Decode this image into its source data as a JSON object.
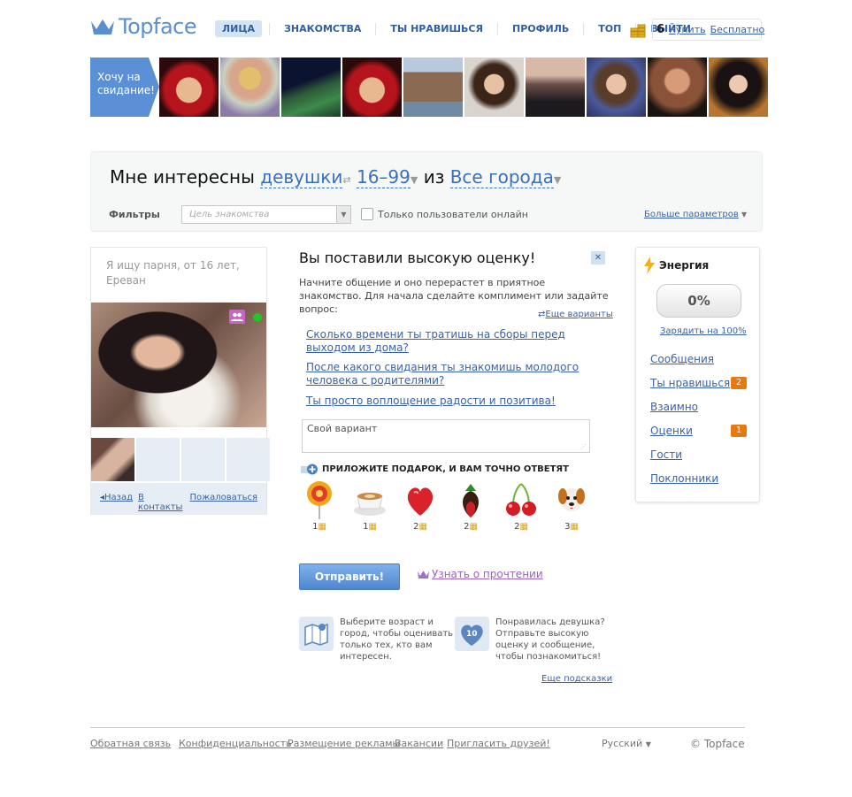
{
  "header": {
    "logo": "Topface",
    "nav": [
      "ЛИЦА",
      "ЗНАКОМСТВА",
      "ТЫ НРАВИШЬСЯ",
      "ПРОФИЛЬ",
      "ТОП",
      "ВЫЙТИ"
    ],
    "balance": "6",
    "buy": "Купить",
    "free": "Бесплатно"
  },
  "strip": {
    "want": "Хочу на свидание!"
  },
  "filter": {
    "lead": "Мне интересны",
    "gender": "девушки",
    "age": "16–99",
    "from": "из",
    "city": "Все города",
    "filters_label": "Фильтры",
    "goal_placeholder": "Цель знакомства",
    "online_only": "Только пользователи онлайн",
    "more_params": "Больше параметров"
  },
  "profile": {
    "line1": "Я ищу парня, от 16 лет,",
    "line2": "Ереван",
    "back": "Назад",
    "contacts": "В контакты",
    "complain": "Пожаловаться"
  },
  "message": {
    "title": "Вы поставили высокую оценку!",
    "close": "✕",
    "intro": "Начните общение и оно перерастет в приятное знакомство. Для начала сделайте комплимент или задайте вопрос:",
    "more_variants": "Еще варианты",
    "questions": [
      "Сколько времени ты тратишь на сборы перед выходом из дома?",
      "После какого свидания ты знакомишь молодого человека с родителями?",
      "Ты просто воплощение радости и позитива!"
    ],
    "own_variant": "Свой вариант",
    "gift_header": "ПРИЛОЖИТЕ ПОДАРОК, И ВАМ ТОЧНО ОТВЕТЯТ",
    "gifts": [
      {
        "icon": "lollipop-icon",
        "price": "1"
      },
      {
        "icon": "coffee-icon",
        "price": "1"
      },
      {
        "icon": "heart-icon",
        "price": "2"
      },
      {
        "icon": "strawberry-icon",
        "price": "2"
      },
      {
        "icon": "cherries-icon",
        "price": "2"
      },
      {
        "icon": "puppy-icon",
        "price": "3"
      }
    ],
    "send": "Отправить!",
    "read_receipt": "Узнать о прочтении"
  },
  "hints": {
    "hint1": [
      "Выберите возраст и",
      "город, чтобы оценивать",
      "только тех, кто вам",
      "интересен."
    ],
    "hint2": [
      "Понравилась девушка?",
      "Отправьте высокую",
      "оценку и сообщение,",
      "чтобы познакомиться!"
    ],
    "hint2_badge": "10",
    "more": "Еще подсказки"
  },
  "energy": {
    "title": "Энергия",
    "percent": "0%",
    "level": 0,
    "charge": "Зарядить на 100%",
    "links": [
      {
        "label": "Сообщения",
        "badge": ""
      },
      {
        "label": "Ты нравишься",
        "badge": "2"
      },
      {
        "label": "Взаимно",
        "badge": ""
      },
      {
        "label": "Оценки",
        "badge": "1"
      },
      {
        "label": "Гости",
        "badge": ""
      },
      {
        "label": "Поклонники",
        "badge": ""
      }
    ]
  },
  "footer": {
    "links": [
      "Обратная связь",
      "Конфиденциальность",
      "Размещение рекламы",
      "Вакансии",
      "Пригласить друзей!"
    ],
    "language": "Русский",
    "copyright": "© Topface"
  },
  "colors": {
    "accent": "#3a62a8",
    "badge": "#e8790e",
    "banner": "#5b8fd6"
  }
}
